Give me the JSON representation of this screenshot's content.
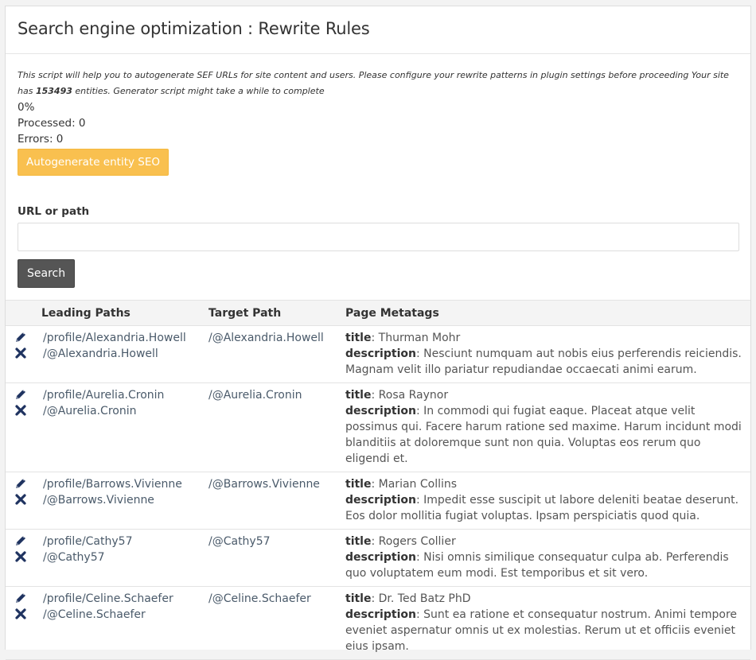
{
  "page": {
    "title": "Search engine optimization : Rewrite Rules",
    "intro_part1": "This script will help you to autogenerate SEF URLs for site content and users. Please configure your rewrite patterns in plugin settings before proceeding Your site has",
    "entity_count": "153493",
    "intro_part2": "entities. Generator script might take a while to complete",
    "progress": "0%",
    "processed": "Processed: 0",
    "errors": "Errors: 0",
    "autogenerate_label": "Autogenerate entity SEO",
    "url_label": "URL or path",
    "url_value": "",
    "search_label": "Search"
  },
  "table": {
    "headers": [
      "",
      "Leading Paths",
      "Target Path",
      "Page Metatags"
    ],
    "title_key": "title",
    "description_key": "description",
    "rows": [
      {
        "leading": [
          "/profile/Alexandria.Howell",
          "/@Alexandria.Howell"
        ],
        "target": "/@Alexandria.Howell",
        "title": ": Thurman Mohr",
        "description": ": Nesciunt numquam aut nobis eius perferendis reiciendis. Magnam velit illo pariatur repudiandae occaecati animi earum."
      },
      {
        "leading": [
          "/profile/Aurelia.Cronin",
          "/@Aurelia.Cronin"
        ],
        "target": "/@Aurelia.Cronin",
        "title": ": Rosa Raynor",
        "description": ": In commodi qui fugiat eaque. Placeat atque velit possimus qui. Facere harum ratione sed maxime. Harum incidunt modi blanditiis at doloremque sunt non quia. Voluptas eos rerum quo eligendi et."
      },
      {
        "leading": [
          "/profile/Barrows.Vivienne",
          "/@Barrows.Vivienne"
        ],
        "target": "/@Barrows.Vivienne",
        "title": ": Marian Collins",
        "description": ": Impedit esse suscipit ut labore deleniti beatae deserunt. Eos dolor mollitia fugiat voluptas. Ipsam perspiciatis quod quia."
      },
      {
        "leading": [
          "/profile/Cathy57",
          "/@Cathy57"
        ],
        "target": "/@Cathy57",
        "title": ": Rogers Collier",
        "description": ": Nisi omnis similique consequatur culpa ab. Perferendis quo voluptatem eum modi. Est temporibus et sit vero."
      },
      {
        "leading": [
          "/profile/Celine.Schaefer",
          "/@Celine.Schaefer"
        ],
        "target": "/@Celine.Schaefer",
        "title": ": Dr. Ted Batz PhD",
        "description": ": Sunt ea ratione et consequatur nostrum. Animi tempore eveniet aspernatur omnis ut ex molestias. Rerum ut et officiis eveniet eius ipsam."
      }
    ]
  },
  "icons": {
    "edit": "pencil-icon",
    "delete": "close-icon",
    "icon_color": "#1f3360"
  },
  "colors": {
    "warning": "#f9c04f",
    "search_button": "#555555"
  }
}
